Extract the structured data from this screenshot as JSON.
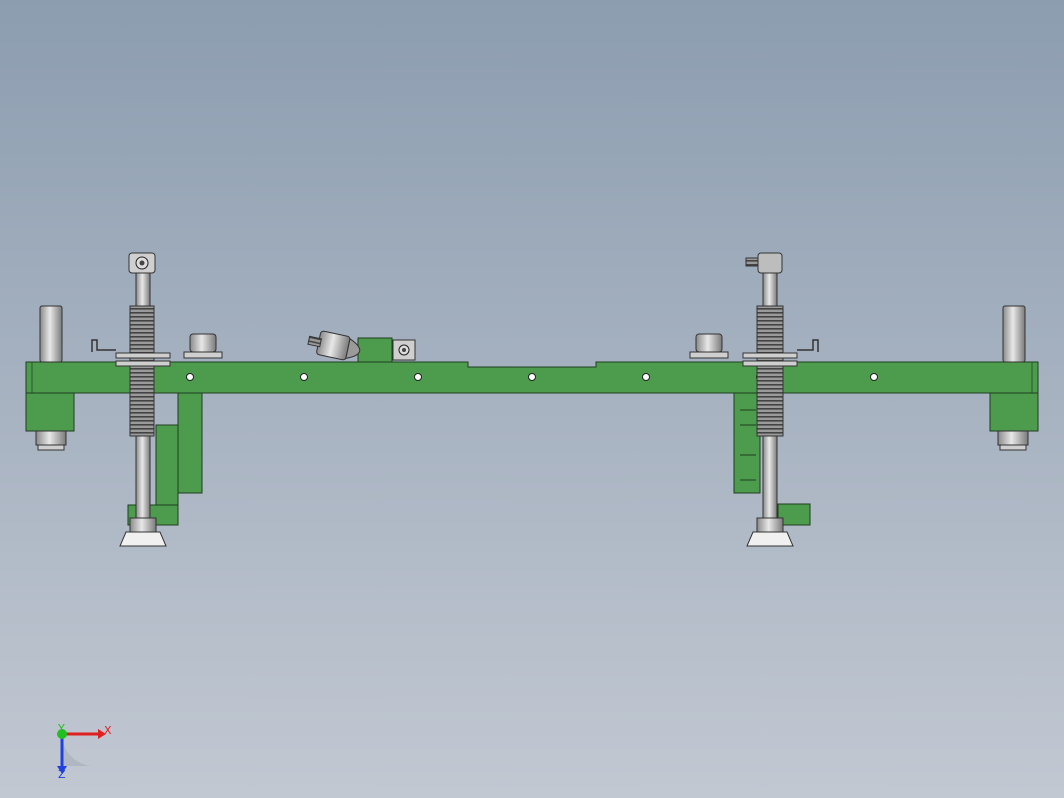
{
  "viewport": {
    "background_top": "#8c9db0",
    "background_bottom": "#c2c8d2"
  },
  "model": {
    "frame_color": "#4d9b4d",
    "frame_edge_color": "#1f3d1f",
    "steel_color": "#b9b9b9",
    "shaft_thread_color": "#6b6b6b"
  },
  "triad": {
    "x_label": "X",
    "y_label": "Y",
    "z_label": "Z",
    "x_color": "#e02020",
    "y_color": "#20c020",
    "z_color": "#2040e0"
  }
}
